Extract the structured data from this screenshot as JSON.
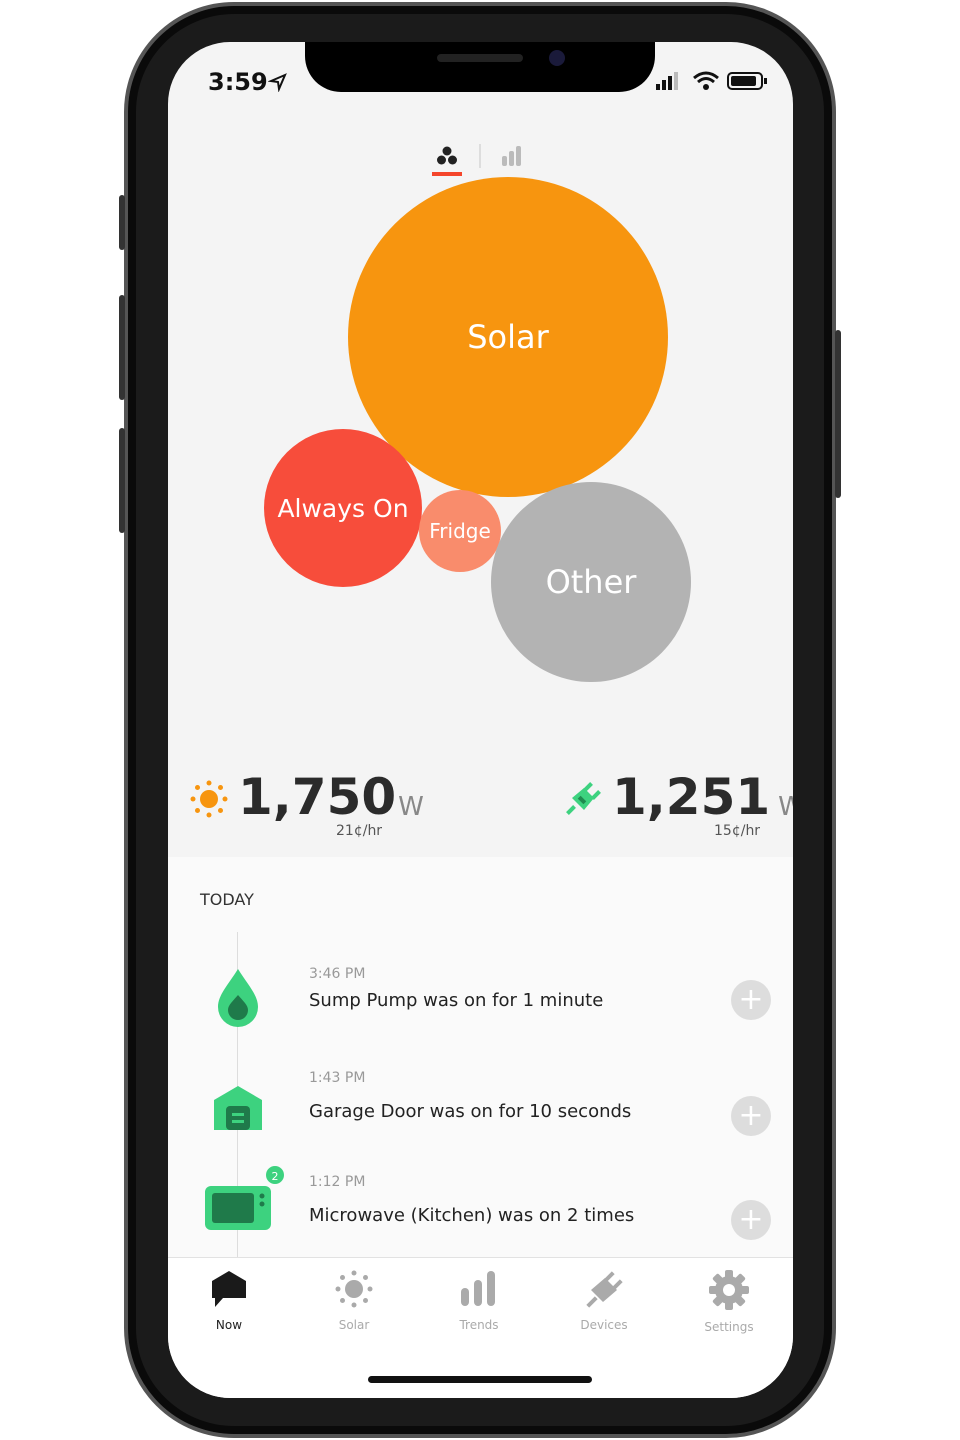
{
  "status_bar": {
    "time": "3:59"
  },
  "view_toggle": {
    "active": "bubbles",
    "options": [
      "bubbles-icon",
      "bar-chart-icon"
    ],
    "accent": "#f4452b"
  },
  "bubbles": [
    {
      "label": "Solar",
      "color": "#f7950f"
    },
    {
      "label": "Always On",
      "color": "#f74d3b"
    },
    {
      "label": "Fridge",
      "color": "#f98c6c"
    },
    {
      "label": "Other",
      "color": "#b3b3b3"
    }
  ],
  "solar_readout": {
    "value": "1,750",
    "unit": "W",
    "rate": "21¢/hr",
    "color": "#f7950f"
  },
  "usage_readout": {
    "value": "1,251",
    "unit": "W",
    "rate": "15¢/hr",
    "color": "#3dd27f"
  },
  "today": {
    "heading": "TODAY",
    "items": [
      {
        "time": "3:46 PM",
        "text": "Sump Pump was on for 1 minute",
        "icon": "water-drop-icon"
      },
      {
        "time": "1:43 PM",
        "text": "Garage Door was on for 10 seconds",
        "icon": "garage-icon"
      },
      {
        "time": "1:12 PM",
        "text": "Microwave (Kitchen) was on 2 times",
        "icon": "microwave-icon",
        "badge": "2"
      }
    ]
  },
  "tabs": [
    {
      "label": "Now",
      "icon": "home-chat-icon",
      "active": true
    },
    {
      "label": "Solar",
      "icon": "sun-icon"
    },
    {
      "label": "Trends",
      "icon": "bar-chart-icon"
    },
    {
      "label": "Devices",
      "icon": "plug-icon"
    },
    {
      "label": "Settings",
      "icon": "gear-icon"
    }
  ]
}
